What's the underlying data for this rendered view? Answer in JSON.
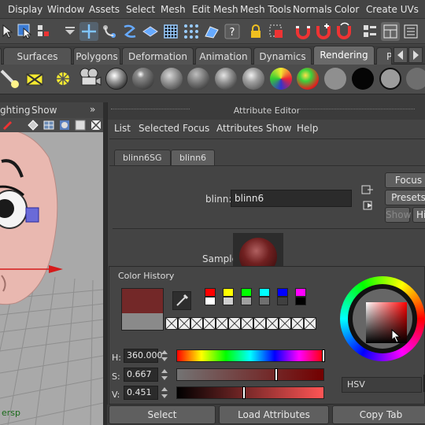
{
  "menubar": {
    "items": [
      "Display",
      "Window",
      "Assets",
      "Select",
      "Mesh",
      "Edit Mesh",
      "Mesh Tools",
      "Normals",
      "Color",
      "Create UVs"
    ]
  },
  "statusline": {
    "icons": [
      "select-arrow-icon",
      "select-object-icon",
      "lasso-object-icon",
      "dropdown-arrow-icon",
      "move-tool-icon",
      "snap-curve-icon",
      "snap-edge-icon",
      "snap-surface-icon",
      "snap-grid-icon",
      "snap-vertex-icon",
      "help-icon",
      "lock-icon",
      "render-region-icon",
      "magnet-icon",
      "magnet-plus-icon",
      "magnet-rotate-icon",
      "outliner-icon",
      "layout-icon",
      "tool-settings-icon"
    ]
  },
  "shelf": {
    "tabs": [
      "Surfaces",
      "Polygons",
      "Deformation",
      "Animation",
      "Dynamics",
      "Rendering",
      "P"
    ],
    "active_tab": "Rendering",
    "icons": [
      "spot-light-icon",
      "area-light-icon",
      "point-light-icon",
      "camera-icon",
      "chrome-sphere-icon",
      "blinn-sphere-icon",
      "lambert-sphere-icon",
      "phong-sphere-icon",
      "anisotropic-sphere-icon",
      "layered-sphere-icon",
      "ramp-sphere-icon",
      "grey-sphere-icon",
      "black-sphere-icon",
      "outline-sphere-icon",
      "toon-sphere-icon"
    ]
  },
  "viewport": {
    "menu": [
      "ghting",
      "Show"
    ],
    "camera_label": "ersp",
    "colors": {
      "background": "#a8a8a8",
      "grid": "#8e8e8e",
      "skin": "#e8b5ae",
      "axis": "#e02020"
    }
  },
  "attribute_editor": {
    "title": "Attribute Editor",
    "menu": [
      "List",
      "Selected",
      "Focus",
      "Attributes",
      "Show",
      "Help"
    ],
    "tabs": [
      "blinn6SG",
      "blinn6"
    ],
    "active_tab": "blinn6",
    "node_label": "blinn:",
    "node_name": "blinn6",
    "buttons": {
      "focus": "Focus",
      "presets": "Presets",
      "show": "Show",
      "hide": "Hi"
    },
    "sample_label": "Sample"
  },
  "color_history": {
    "title": "Color History",
    "current_color": "#732828",
    "previous_color": "#8a8a8a",
    "palette_row1": [
      "#ff0000",
      "#ffff00",
      "#00ff00",
      "#00ffff",
      "#0000ff",
      "#ff00ff"
    ],
    "palette_row2": [
      "#ffffff",
      "#d0d0d0",
      "#a0a0a0",
      "#707070",
      "#404040",
      "#000000"
    ],
    "h_label": "H:",
    "h_value": "360.000",
    "s_label": "S:",
    "s_value": "0.667",
    "v_label": "V:",
    "v_value": "0.451",
    "mode_label": "HSV"
  },
  "bottom_buttons": {
    "select": "Select",
    "load": "Load Attributes",
    "copy": "Copy Tab"
  }
}
